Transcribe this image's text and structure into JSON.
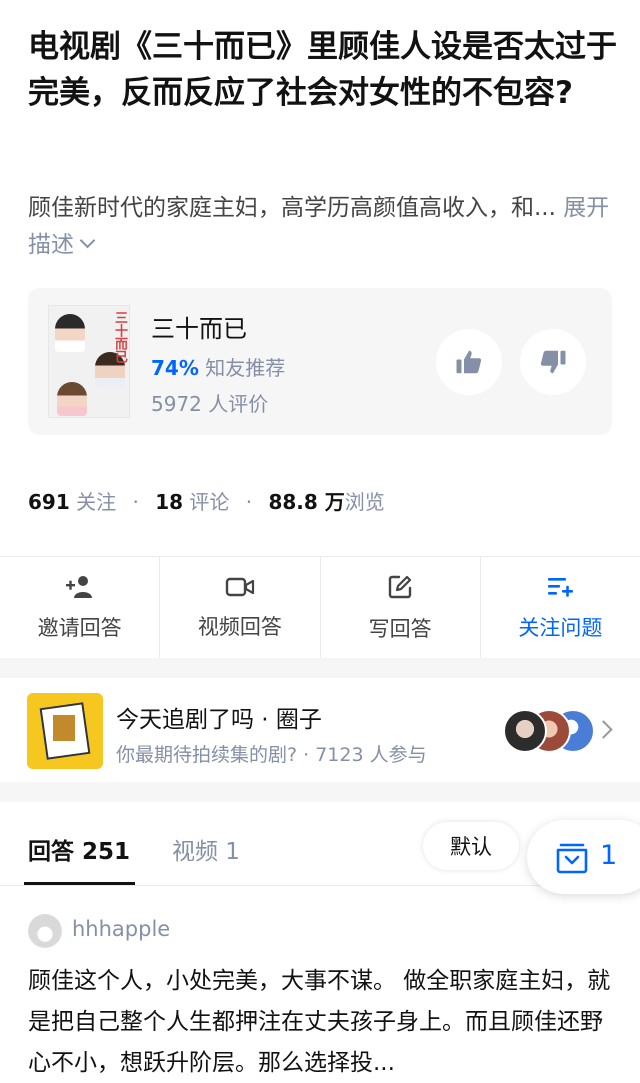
{
  "question": {
    "title": "电视剧《三十而已》里顾佳人设是否太过于完美，反而反应了社会对女性的不包容?",
    "description": "顾佳新时代的家庭主妇，高学历高颜值高收入，和...",
    "expand_label": "展开描述"
  },
  "show_card": {
    "name": "三十而已",
    "poster_logo": "三十而已",
    "recommend_percent": "74%",
    "recommend_label": "知友推荐",
    "rating_count": "5972 人评价"
  },
  "stats": {
    "follow_count": "691",
    "follow_label": "关注",
    "comment_count": "18",
    "comment_label": "评论",
    "view_count": "88.8 万",
    "view_label": "浏览",
    "separator": "·"
  },
  "actions": [
    {
      "label": "邀请回答",
      "icon": "add-user-icon"
    },
    {
      "label": "视频回答",
      "icon": "video-camera-icon"
    },
    {
      "label": "写回答",
      "icon": "edit-icon"
    },
    {
      "label": "关注问题",
      "icon": "follow-list-icon"
    }
  ],
  "circle": {
    "name": "今天追剧了吗 · 圈子",
    "subtitle": "你最期待拍续集的剧? · 7123 人参与"
  },
  "tabs": {
    "answers_label": "回答 251",
    "videos_label": "视频 1",
    "sort_label": "默认",
    "float_count": "1"
  },
  "answer": {
    "author": "hhhapple",
    "excerpt": "顾佳这个人，小处完美，大事不谋。 做全职家庭主妇，就是把自己整个人生都押注在丈夫孩子身上。而且顾佳还野心不小，想跃升阶层。那么选择投..."
  },
  "colors": {
    "accent": "#0066ff",
    "muted": "#8590a6",
    "text": "#121212",
    "divider": "#f6f6f6"
  }
}
